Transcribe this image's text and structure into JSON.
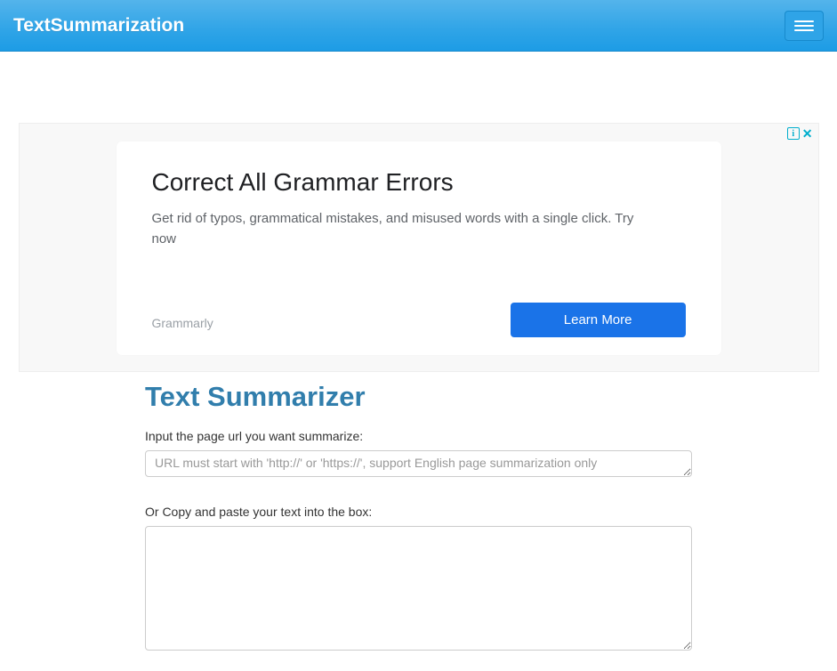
{
  "navbar": {
    "brand": "TextSummarization"
  },
  "ad": {
    "title": "Correct All Grammar Errors",
    "subtitle": "Get rid of typos, grammatical mistakes, and misused words with a single click. Try now",
    "brand": "Grammarly",
    "button": "Learn More",
    "info_glyph": "i",
    "close_glyph": "✕"
  },
  "main": {
    "heading": "Text Summarizer",
    "url_label": "Input the page url you want summarize:",
    "url_placeholder": "URL must start with 'http://' or 'https://', support English page summarization only",
    "text_label": "Or Copy and paste your text into the box:"
  }
}
